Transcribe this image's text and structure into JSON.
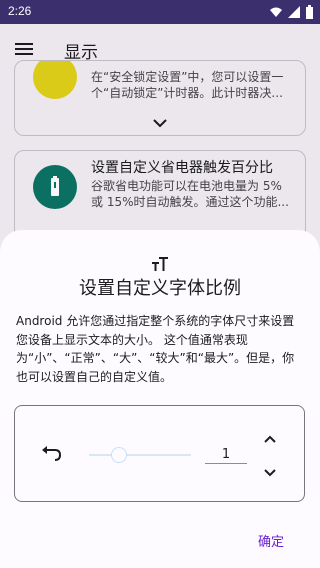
{
  "status_bar": {
    "time": "2:26"
  },
  "app_bar": {
    "title": "显示"
  },
  "cards": [
    {
      "description": "在“安全锁定设置”中，您可以设置一个“自动锁定”计时器。此计时器决..."
    },
    {
      "title": "设置自定义省电器触发百分比",
      "description": "谷歌省电功能可以在电池电量为 5% 或 15%时自动触发。通过这个功能..."
    }
  ],
  "sheet": {
    "title": "设置自定义字体比例",
    "description": "Android 允许您通过指定整个系统的字体尺寸来设置您设备上显示文本的大小。 这个值通常表现为“小”、“正常”、“大”、“较大”和“最大”。但是，你也可以设置自己的自定义值。",
    "value": "1",
    "confirm_label": "确定"
  },
  "colors": {
    "status_bar": "#3c2f6e",
    "accent": "#6a1fd1",
    "card_1_icon": "#e3d21a",
    "card_2_icon": "#0c7466"
  },
  "icons": [
    "menu-icon",
    "sync-icon",
    "battery-icon",
    "font-size-icon",
    "undo-icon",
    "chevron-up-icon",
    "chevron-down-icon"
  ]
}
